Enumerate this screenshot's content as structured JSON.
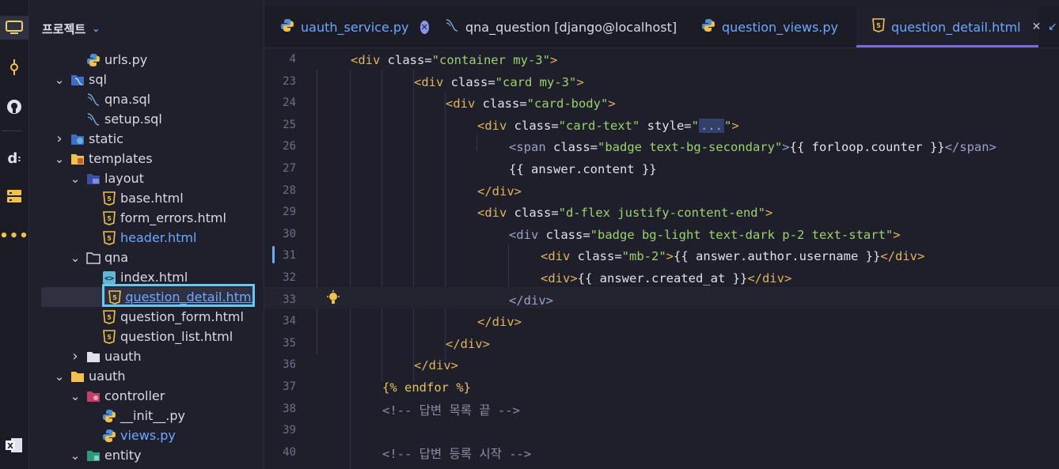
{
  "activity_icons": [
    "monitor-icon",
    "commit-icon",
    "github-icon",
    "docker-icon",
    "database-icon",
    "more-icon",
    "excel-icon"
  ],
  "sidebar": {
    "title": "프로젝트",
    "items": [
      {
        "label": "urls.py",
        "depth": 3,
        "icon": "python",
        "arrow": ""
      },
      {
        "label": "sql",
        "depth": 2,
        "icon": "folder-sql",
        "arrow": "v"
      },
      {
        "label": "qna.sql",
        "depth": 3,
        "icon": "sql-file",
        "arrow": ""
      },
      {
        "label": "setup.sql",
        "depth": 3,
        "icon": "sql-file",
        "arrow": ""
      },
      {
        "label": "static",
        "depth": 2,
        "icon": "folder-web",
        "arrow": ">"
      },
      {
        "label": "templates",
        "depth": 2,
        "icon": "folder-templates",
        "arrow": "v"
      },
      {
        "label": "layout",
        "depth": 3,
        "icon": "folder-layout",
        "arrow": "v"
      },
      {
        "label": "base.html",
        "depth": 4,
        "icon": "html",
        "arrow": ""
      },
      {
        "label": "form_errors.html",
        "depth": 4,
        "icon": "html",
        "arrow": ""
      },
      {
        "label": "header.html",
        "depth": 4,
        "icon": "html",
        "arrow": "",
        "style": "link"
      },
      {
        "label": "qna",
        "depth": 3,
        "icon": "folder-outline",
        "arrow": "v"
      },
      {
        "label": "index.html",
        "depth": 4,
        "icon": "html-code",
        "arrow": ""
      },
      {
        "label": "question_detail.html",
        "depth": 4,
        "icon": "html",
        "arrow": "",
        "style": "selected"
      },
      {
        "label": "question_form.html",
        "depth": 4,
        "icon": "html",
        "arrow": ""
      },
      {
        "label": "question_list.html",
        "depth": 4,
        "icon": "html",
        "arrow": ""
      },
      {
        "label": "uauth",
        "depth": 3,
        "icon": "folder-gray",
        "arrow": ">"
      },
      {
        "label": "uauth",
        "depth": 2,
        "icon": "folder-yellow",
        "arrow": "v"
      },
      {
        "label": "controller",
        "depth": 3,
        "icon": "folder-controller",
        "arrow": "v"
      },
      {
        "label": "__init__.py",
        "depth": 4,
        "icon": "python",
        "arrow": ""
      },
      {
        "label": "views.py",
        "depth": 4,
        "icon": "python",
        "arrow": "",
        "style": "link"
      },
      {
        "label": "entity",
        "depth": 3,
        "icon": "folder-entity",
        "arrow": "v"
      }
    ]
  },
  "tabs": [
    {
      "label": "uauth_service.py",
      "icon": "python",
      "close": "circle",
      "style": "link"
    },
    {
      "label": "qna_question [django@localhost]",
      "icon": "sql-file",
      "close": "",
      "style": "plain"
    },
    {
      "label": "question_views.py",
      "icon": "python",
      "close": "",
      "style": "link"
    },
    {
      "label": "question_detail.html",
      "icon": "html",
      "close": "x",
      "style": "link",
      "active": true
    }
  ],
  "editor": {
    "lines": [
      {
        "num": "4",
        "indent": 0,
        "parts": [
          [
            "tag",
            "<div"
          ],
          [
            "attr",
            " class="
          ],
          [
            "str",
            "\"container my-3\""
          ],
          [
            "tag",
            ">"
          ]
        ]
      },
      {
        "num": "23",
        "indent": 2,
        "parts": [
          [
            "tag",
            "<div"
          ],
          [
            "attr",
            " class="
          ],
          [
            "str",
            "\"card my-3\""
          ],
          [
            "tag",
            ">"
          ]
        ]
      },
      {
        "num": "24",
        "indent": 3,
        "parts": [
          [
            "tag",
            "<div"
          ],
          [
            "attr",
            " class="
          ],
          [
            "str",
            "\"card-body\""
          ],
          [
            "tag",
            ">"
          ]
        ]
      },
      {
        "num": "25",
        "indent": 4,
        "parts": [
          [
            "tag",
            "<div"
          ],
          [
            "attr",
            " class="
          ],
          [
            "str",
            "\"card-text\""
          ],
          [
            "attr",
            " style="
          ],
          [
            "str",
            "\""
          ],
          [
            "tag-dim",
            "..."
          ],
          [
            "str",
            "\""
          ],
          [
            "tag",
            ">"
          ]
        ]
      },
      {
        "num": "26",
        "indent": 5,
        "parts": [
          [
            "tag-dim",
            "<span"
          ],
          [
            "attr",
            " class="
          ],
          [
            "str",
            "\"badge text-bg-secondary\""
          ],
          [
            "tag-dim",
            ">"
          ],
          [
            "attr",
            "{{ forloop.counter }}"
          ],
          [
            "tag-dim",
            "</span>"
          ]
        ]
      },
      {
        "num": "27",
        "indent": 5,
        "parts": [
          [
            "attr",
            "{{ answer.content }}"
          ]
        ]
      },
      {
        "num": "28",
        "indent": 4,
        "parts": [
          [
            "tag",
            "</div>"
          ]
        ]
      },
      {
        "num": "29",
        "indent": 4,
        "parts": [
          [
            "tag",
            "<div"
          ],
          [
            "attr",
            " class="
          ],
          [
            "str",
            "\"d-flex justify-content-end\""
          ],
          [
            "tag",
            ">"
          ]
        ]
      },
      {
        "num": "30",
        "indent": 5,
        "parts": [
          [
            "tag-dim",
            "<div"
          ],
          [
            "attr",
            " class="
          ],
          [
            "str",
            "\"badge bg-light text-dark p-2 text-start\""
          ],
          [
            "tag",
            ">"
          ]
        ]
      },
      {
        "num": "31",
        "indent": 6,
        "parts": [
          [
            "tag",
            "<div"
          ],
          [
            "attr",
            " class="
          ],
          [
            "str",
            "\"mb-2\""
          ],
          [
            "tag",
            ">"
          ],
          [
            "attr",
            "{{ answer.author.username }}"
          ],
          [
            "tag",
            "</div>"
          ]
        ]
      },
      {
        "num": "32",
        "indent": 6,
        "parts": [
          [
            "tag",
            "<div>"
          ],
          [
            "attr",
            "{{ answer.created_at }}"
          ],
          [
            "tag",
            "</div>"
          ]
        ]
      },
      {
        "num": "33",
        "indent": 5,
        "parts": [
          [
            "tag-dim",
            "</div>"
          ]
        ]
      },
      {
        "num": "34",
        "indent": 4,
        "parts": [
          [
            "tag",
            "</div>"
          ]
        ]
      },
      {
        "num": "35",
        "indent": 3,
        "parts": [
          [
            "tag",
            "</div>"
          ]
        ]
      },
      {
        "num": "36",
        "indent": 2,
        "parts": [
          [
            "tag",
            "</div>"
          ]
        ]
      },
      {
        "num": "37",
        "indent": 1,
        "parts": [
          [
            "tpl",
            "{% endfor %}"
          ]
        ]
      },
      {
        "num": "38",
        "indent": 1,
        "parts": [
          [
            "cmt",
            "<!-- 답변 목록 끝 -->"
          ]
        ]
      },
      {
        "num": "39",
        "indent": 0,
        "parts": []
      },
      {
        "num": "40",
        "indent": 1,
        "parts": [
          [
            "cmt",
            "<!-- 답변 등록 시작 -->"
          ]
        ]
      }
    ]
  }
}
